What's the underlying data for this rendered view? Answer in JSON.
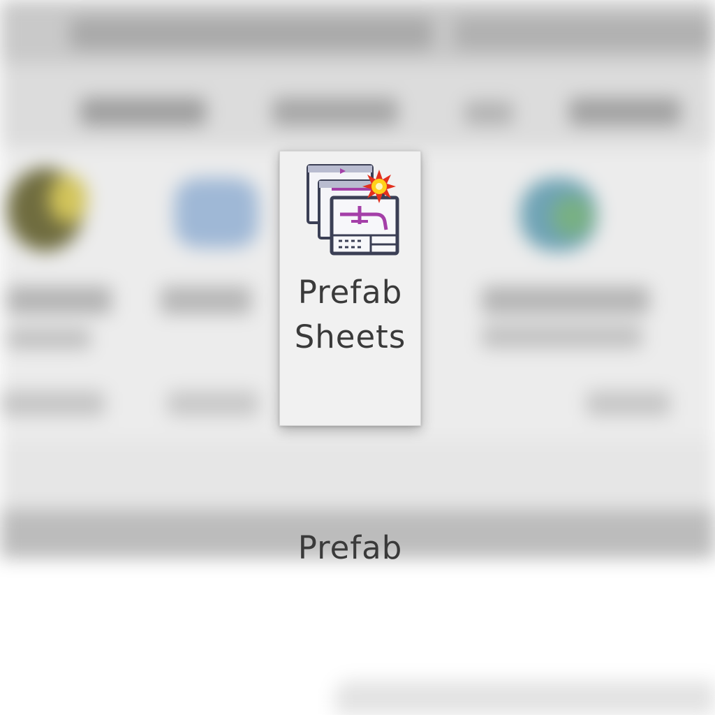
{
  "ribbon": {
    "button": {
      "icon": "prefab-sheets-icon",
      "label_line1": "Prefab",
      "label_line2": "Sheets"
    },
    "panel_label": "Prefab"
  },
  "colors": {
    "accent_purple": "#a43fa8",
    "sheet_border": "#3b3f55",
    "starburst_red": "#e2301e",
    "starburst_yellow": "#ffd11a",
    "button_bg": "#f1f1f1"
  }
}
